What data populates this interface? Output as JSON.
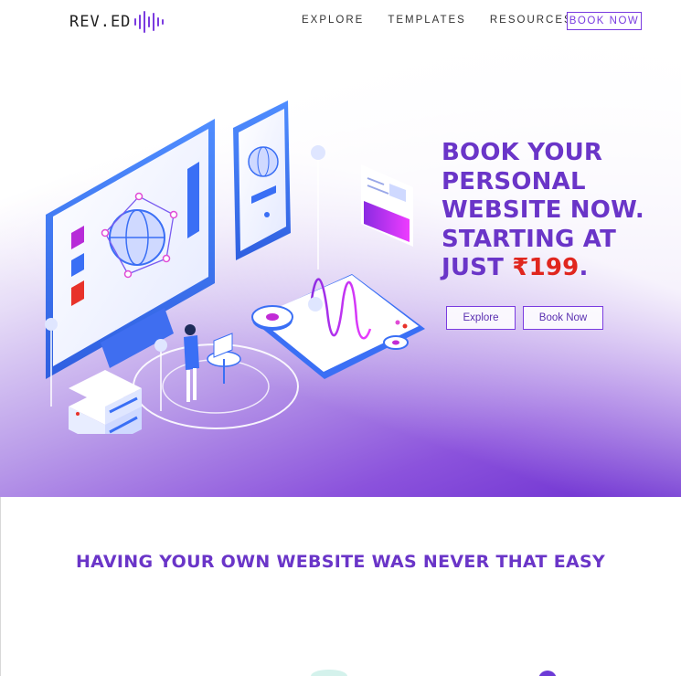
{
  "brand": {
    "logo_text": "REV.ED",
    "accent_color": "#7a3be0"
  },
  "nav": {
    "items": [
      {
        "label": "EXPLORE"
      },
      {
        "label": "TEMPLATES"
      },
      {
        "label": "RESOURCES"
      }
    ],
    "cta_label": "BOOK NOW"
  },
  "hero": {
    "title_line1": "BOOK YOUR",
    "title_line2": "PERSONAL",
    "title_line3": "WEBSITE NOW.",
    "title_line4": "STARTING AT",
    "title_line5_prefix": "JUST ",
    "price": "₹199",
    "title_line5_suffix": ".",
    "explore_label": "Explore",
    "book_label": "Book Now",
    "title_color": "#6a35c8",
    "price_color": "#e0261e"
  },
  "section": {
    "title": "HAVING YOUR OWN WEBSITE WAS NEVER THAT EASY"
  }
}
